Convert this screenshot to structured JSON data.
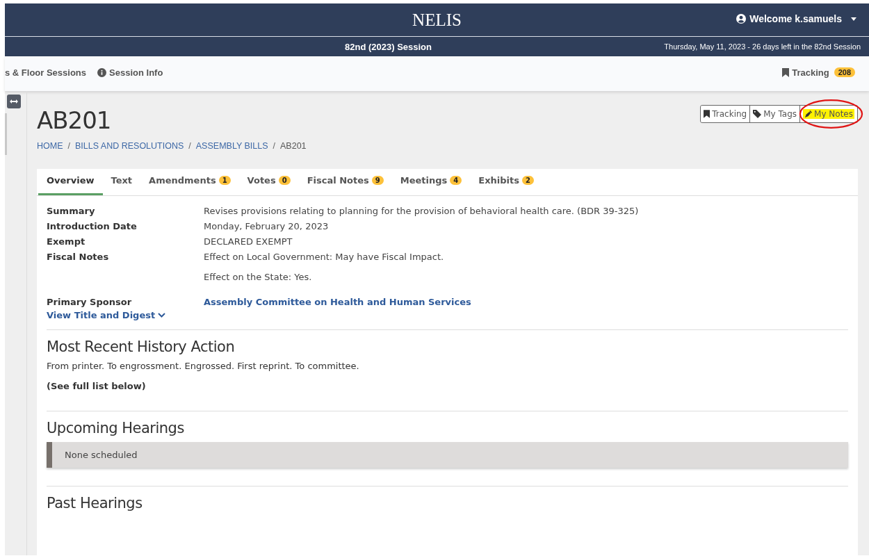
{
  "header": {
    "title": "NELIS",
    "user": "Welcome k.samuels",
    "session": "82nd (2023) Session",
    "date_note": "Thursday, May 11, 2023 - 26 days left in the 82nd Session"
  },
  "nav": {
    "items": [
      {
        "label": "s & Floor Sessions"
      },
      {
        "label": "Session Info"
      }
    ],
    "tracking": {
      "label": "Tracking",
      "count": "208"
    }
  },
  "bill": {
    "title": "AB201",
    "breadcrumb_separator": "/",
    "breadcrumb": [
      {
        "label": "HOME",
        "link": true
      },
      {
        "label": "BILLS AND RESOLUTIONS",
        "link": true
      },
      {
        "label": "ASSEMBLY BILLS",
        "link": true
      },
      {
        "label": "AB201",
        "link": false
      }
    ],
    "actions": [
      {
        "label": "Tracking",
        "highlighted": false,
        "circled": false
      },
      {
        "label": "My Tags",
        "highlighted": false,
        "circled": false
      },
      {
        "label": "My Notes",
        "highlighted": true,
        "circled": true
      }
    ]
  },
  "tabs": [
    {
      "label": "Overview",
      "selected": true
    },
    {
      "label": "Text",
      "selected": false
    },
    {
      "label": "Amendments",
      "count": "1",
      "selected": false
    },
    {
      "label": "Votes",
      "count": "0",
      "selected": false
    },
    {
      "label": "Fiscal Notes",
      "count": "9",
      "selected": false
    },
    {
      "label": "Meetings",
      "count": "4",
      "selected": false
    },
    {
      "label": "Exhibits",
      "count": "2",
      "selected": false
    }
  ],
  "overview": [
    {
      "label": "Summary",
      "values": [
        "Revises provisions relating to planning for the provision of behavioral health care. (BDR 39-325)"
      ],
      "kind": "text"
    },
    {
      "label": "Introduction Date",
      "values": [
        "Monday, February 20, 2023"
      ],
      "kind": "text"
    },
    {
      "label": "Exempt",
      "values": [
        "DECLARED EXEMPT"
      ],
      "kind": "text"
    },
    {
      "label": "Fiscal Notes",
      "values": [
        "Effect on Local Government: May have Fiscal Impact.",
        "Effect on the State: Yes."
      ],
      "kind": "text"
    },
    {
      "label": "Primary Sponsor",
      "values": [
        "Assembly Committee on Health and Human Services"
      ],
      "kind": "link"
    }
  ],
  "digest_link": "View Title and Digest",
  "history": {
    "heading": "Most Recent History Action",
    "text": "From printer. To engrossment. Engrossed. First reprint. To committee.",
    "note": "(See full list below)"
  },
  "upcoming": {
    "heading": "Upcoming Hearings",
    "message": "None scheduled"
  },
  "past": {
    "heading": "Past Hearings"
  }
}
